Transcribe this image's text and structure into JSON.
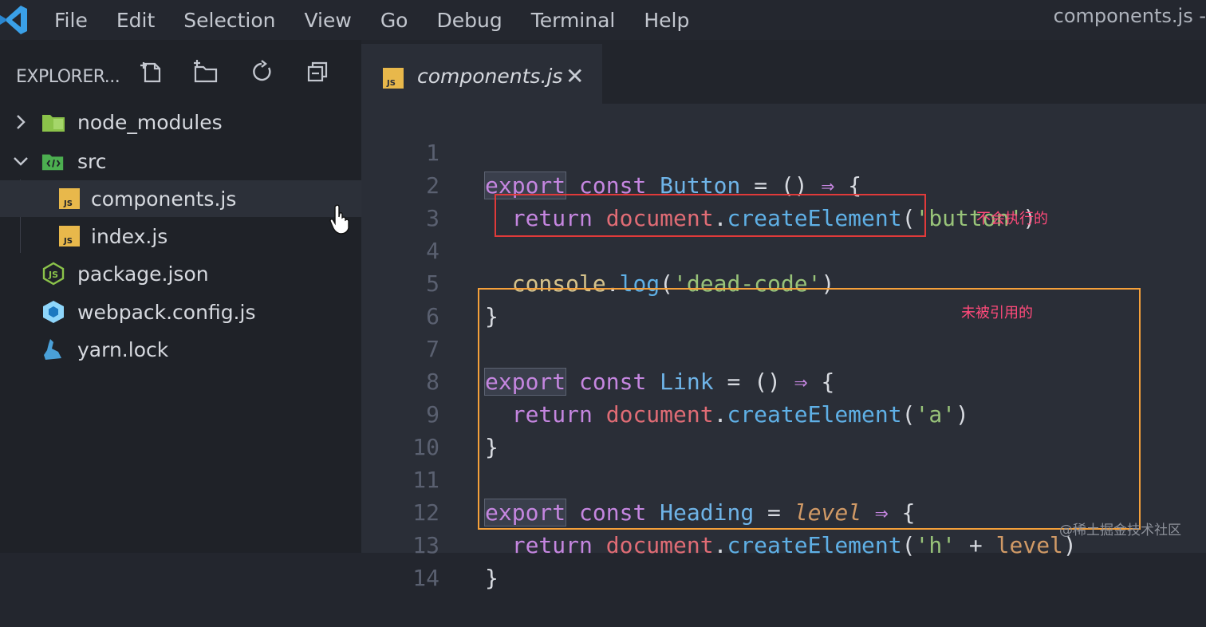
{
  "menubar": {
    "items": [
      "File",
      "Edit",
      "Selection",
      "View",
      "Go",
      "Debug",
      "Terminal",
      "Help"
    ],
    "window_title": "components.js -"
  },
  "sidebar": {
    "title": "EXPLORER...",
    "tree": [
      {
        "label": "node_modules",
        "kind": "folder",
        "expanded": false
      },
      {
        "label": "src",
        "kind": "folder-src",
        "expanded": true
      },
      {
        "label": "components.js",
        "kind": "js",
        "selected": true
      },
      {
        "label": "index.js",
        "kind": "js"
      },
      {
        "label": "package.json",
        "kind": "node"
      },
      {
        "label": "webpack.config.js",
        "kind": "webpack"
      },
      {
        "label": "yarn.lock",
        "kind": "yarn"
      }
    ]
  },
  "editor": {
    "tab": {
      "label": "components.js",
      "close": "✕",
      "badge": "JS"
    },
    "line_numbers": [
      "1",
      "2",
      "3",
      "4",
      "5",
      "6",
      "7",
      "8",
      "9",
      "10",
      "11",
      "12",
      "13",
      "14"
    ]
  },
  "annotations": {
    "red_note": "不会执行的",
    "orange_note": "未被引用的"
  },
  "watermark": "@稀土掘金技术社区",
  "colors": {
    "red_box": "#e03a3a",
    "orange_box": "#f5a03a",
    "note_text": "#ff4a7a",
    "vscode_blue": "#3aa0e8"
  }
}
